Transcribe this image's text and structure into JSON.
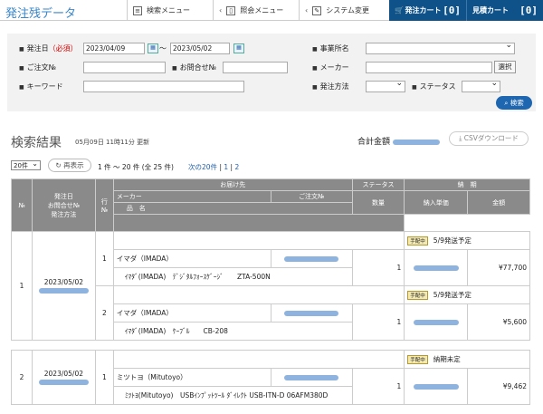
{
  "header": {
    "title": "発注残データ",
    "menus": [
      "検索メニュー",
      "照会メニュー",
      "システム変更"
    ],
    "carts": [
      {
        "label": "発注カート",
        "count": "[0]"
      },
      {
        "label": "見積カート",
        "count": "[0]"
      }
    ]
  },
  "search": {
    "order_date_label": "発注日",
    "required_label": "（必須）",
    "date_from": "2023/04/09",
    "date_tilde": "～",
    "date_to": "2023/05/02",
    "business_label": "事業所名",
    "order_no_label": "ご注文№",
    "inquiry_no_label": "お問合せ№",
    "maker_label": "メーカー",
    "select_button": "選択",
    "keyword_label": "キーワード",
    "method_label": "発注方法",
    "status_label": "ステータス",
    "search_button": "検索"
  },
  "results": {
    "title": "検索結果",
    "updated": "05月09日 11時11分 更新",
    "total_label": "合計金額",
    "csv_button": "CSVダウンロード",
    "per_page": "20件",
    "reload_button": "再表示",
    "range": "1 件 ～ 20 件 (全 25 件)",
    "next": "次の20件",
    "pages": [
      "1",
      "2"
    ],
    "pipe": "|"
  },
  "table": {
    "headers": {
      "no": "№",
      "order_date": "発注日",
      "inquiry_no": "お問合せ№",
      "method": "発注方法",
      "line_no": "行№",
      "delivery": "お届け先",
      "maker": "メーカー",
      "order_no": "ご注文№",
      "product": "品　名",
      "status": "ステータス",
      "qty": "数量",
      "due": "納　期",
      "unit_price": "納入単価",
      "amount": "金額"
    },
    "orders": [
      {
        "no": "1",
        "date": "2023/05/02",
        "lines": [
          {
            "line": "1",
            "badge": "手配中",
            "due": "5/9発送予定",
            "maker": "イマダ（IMADA）",
            "product": "ｲﾏﾀﾞ(IMADA)　ﾃﾞｼﾞﾀﾙﾌｫｰｽｹﾞｰｼﾞ　　ZTA-500N",
            "qty": "1",
            "amount": "¥77,700"
          },
          {
            "line": "2",
            "badge": "手配中",
            "due": "5/9発送予定",
            "maker": "イマダ（IMADA）",
            "product": "ｲﾏﾀﾞ(IMADA)　ｹｰﾌﾞﾙ　　CB-208",
            "qty": "1",
            "amount": "¥5,600"
          }
        ]
      },
      {
        "no": "2",
        "date": "2023/05/02",
        "lines": [
          {
            "line": "1",
            "badge": "手配中",
            "due": "納期未定",
            "maker": "ミツトヨ（Mitutoyo）",
            "product": "ﾐﾂﾄﾖ(Mitutoyo)　USBｲﾝﾌﾟｯﾄﾂｰﾙ ﾀﾞｲﾚｸﾄ USB-ITN-D 06AFM380D",
            "qty": "1",
            "amount": "¥9,462"
          }
        ]
      }
    ]
  },
  "colors": {
    "brand": "#0f5289",
    "title": "#3a86c7",
    "table_header": "#8a8a8a",
    "link": "#1e5fb0"
  }
}
